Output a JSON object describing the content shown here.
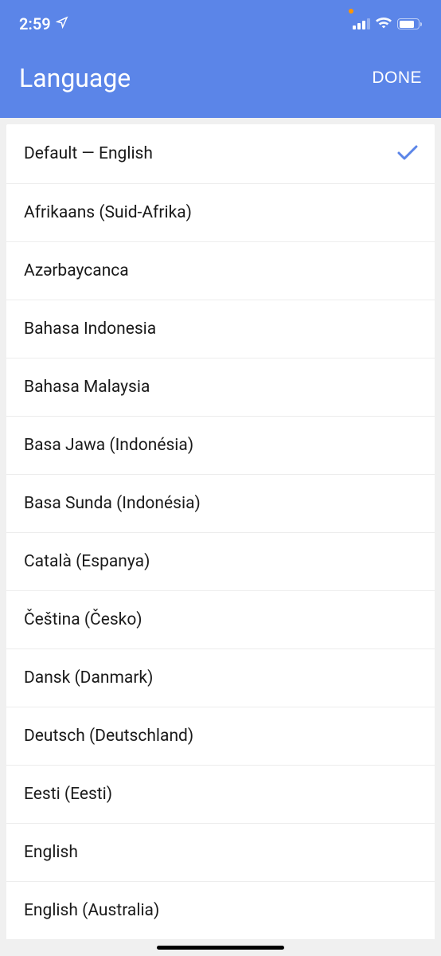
{
  "statusBar": {
    "time": "2:59"
  },
  "nav": {
    "title": "Language",
    "doneLabel": "DONE"
  },
  "languages": [
    {
      "label": "Default — English",
      "selected": true
    },
    {
      "label": "Afrikaans (Suid-Afrika)",
      "selected": false
    },
    {
      "label": "Azərbaycanca",
      "selected": false
    },
    {
      "label": "Bahasa Indonesia",
      "selected": false
    },
    {
      "label": "Bahasa Malaysia",
      "selected": false
    },
    {
      "label": "Basa Jawa (Indonésia)",
      "selected": false
    },
    {
      "label": "Basa Sunda (Indonésia)",
      "selected": false
    },
    {
      "label": "Català (Espanya)",
      "selected": false
    },
    {
      "label": "Čeština (Česko)",
      "selected": false
    },
    {
      "label": "Dansk (Danmark)",
      "selected": false
    },
    {
      "label": "Deutsch (Deutschland)",
      "selected": false
    },
    {
      "label": "Eesti (Eesti)",
      "selected": false
    },
    {
      "label": "English",
      "selected": false
    },
    {
      "label": "English (Australia)",
      "selected": false
    }
  ]
}
